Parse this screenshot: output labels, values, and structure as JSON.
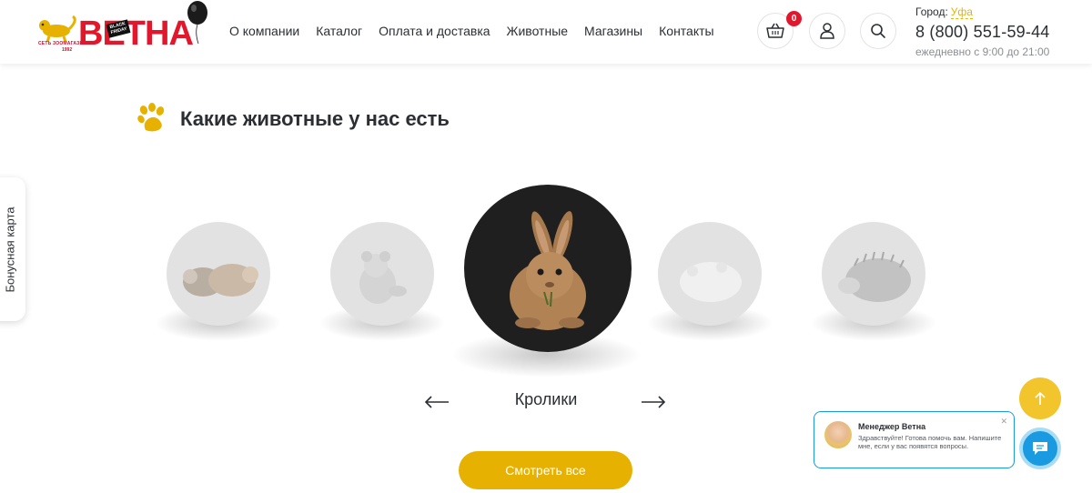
{
  "header": {
    "logo": {
      "text": "ВЕТНА",
      "subtitle": "СЕТЬ ЗООМАГАЗИНОВ",
      "year": "1992",
      "tag_line1": "BLACK",
      "tag_line2": "FRIDAY"
    },
    "nav": [
      "О компании",
      "Каталог",
      "Оплата и доставка",
      "Животные",
      "Магазины",
      "Контакты"
    ],
    "cart_count": "0",
    "city_label": "Город:",
    "city_name": "Уфа",
    "phone": "8 (800) 551-59-44",
    "hours": "ежедневно с 9:00 до 21:00"
  },
  "section": {
    "title": "Какие животные у нас есть",
    "active_caption": "Кролики",
    "button_label": "Смотреть все",
    "animals": [
      {
        "name": "guinea-pigs",
        "active": false
      },
      {
        "name": "chinchilla",
        "active": false
      },
      {
        "name": "rabbit",
        "active": true
      },
      {
        "name": "hamster",
        "active": false
      },
      {
        "name": "hedgehog",
        "active": false
      }
    ]
  },
  "bonus_tab": "Бонусная карта",
  "chat": {
    "manager_name": "Менеджер Ветна",
    "message": "Здравствуйте! Готова помочь вам. Напишите мне, если у вас появятся вопросы."
  },
  "colors": {
    "accent": "#e6b100",
    "brand_red": "#e3172b",
    "chat_blue": "#1a9ae0"
  }
}
